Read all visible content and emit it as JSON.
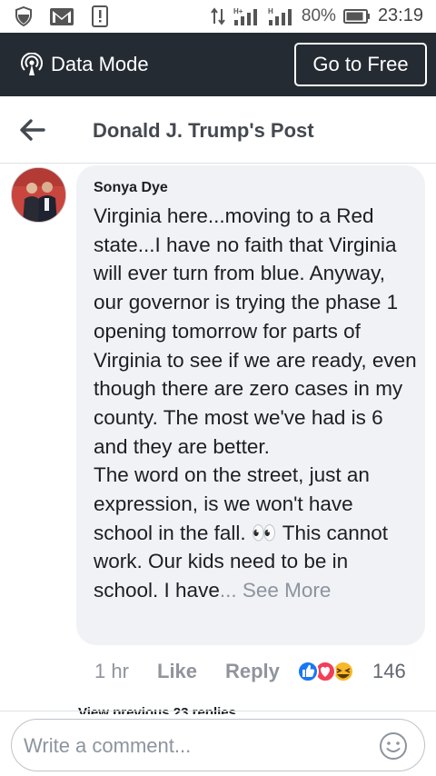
{
  "status_bar": {
    "battery": "80%",
    "time": "23:19",
    "net_1": "H+",
    "net_2": "H"
  },
  "data_mode": {
    "label": "Data Mode",
    "button": "Go to Free"
  },
  "header": {
    "title": "Donald J. Trump's Post"
  },
  "comment": {
    "author": "Sonya Dye",
    "text": "Virginia here...moving to a Red state...I have no faith that Virginia will ever turn from blue. Anyway, our governor is trying the phase 1 opening tomorrow for parts of Virginia to see if we are ready, even though there are zero cases in my county. The most we've had is 6 and they are better.\nThe word on the street, just an expression, is we won't have school in the fall. 👀 This cannot work. Our kids need to be in school. I have",
    "ellipsis": "...",
    "see_more": "See More",
    "time": "1 hr",
    "like_label": "Like",
    "reply_label": "Reply",
    "reaction_count": "146",
    "reactions": [
      "like-reaction",
      "love-reaction",
      "haha-reaction"
    ]
  },
  "replies": {
    "view_previous": "View previous 23 replies"
  },
  "composer": {
    "placeholder": "Write a comment..."
  },
  "colors": {
    "brand_dark": "#252b33",
    "bubble": "#f0f2f5",
    "muted": "#90949c",
    "like_blue": "#1877f2",
    "love_red": "#f33e58",
    "haha_yellow": "#f7b928"
  }
}
